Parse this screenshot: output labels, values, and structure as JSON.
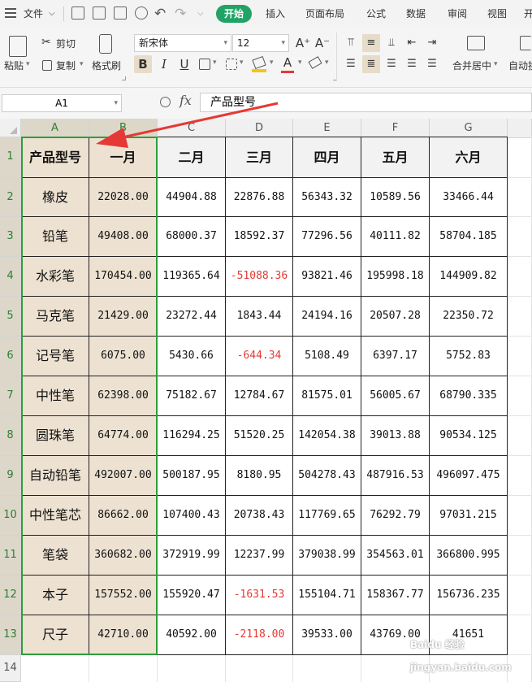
{
  "menubar": {
    "file_label": "文件",
    "tabs": [
      "开始",
      "插入",
      "页面布局",
      "公式",
      "数据",
      "审阅",
      "视图",
      "开"
    ],
    "active_tab": "开始"
  },
  "toolbar": {
    "paste_label": "粘贴",
    "cut_label": "剪切",
    "copy_label": "复制",
    "format_painter_label": "格式刷",
    "font_name": "新宋体",
    "font_size": "12",
    "bold": "B",
    "italic": "I",
    "underline": "U",
    "font_color_glyph": "A",
    "grow_font": "A⁺",
    "shrink_font": "A⁻",
    "merge_center_label": "合并居中",
    "wrap_label": "自动换"
  },
  "formula_bar": {
    "name_box": "A1",
    "fx_label": "fx",
    "content": "产品型号"
  },
  "columns": [
    "A",
    "B",
    "C",
    "D",
    "E",
    "F",
    "G"
  ],
  "selected_columns": [
    "A",
    "B"
  ],
  "rows": [
    "1",
    "2",
    "3",
    "4",
    "5",
    "6",
    "7",
    "8",
    "9",
    "10",
    "11",
    "12",
    "13",
    "14"
  ],
  "table": {
    "headers": [
      "产品型号",
      "一月",
      "二月",
      "三月",
      "四月",
      "五月",
      "六月"
    ],
    "rows": [
      [
        "橡皮",
        "22028.00",
        "44904.88",
        "22876.88",
        "56343.32",
        "10589.56",
        "33466.44"
      ],
      [
        "铅笔",
        "49408.00",
        "68000.37",
        "18592.37",
        "77296.56",
        "40111.82",
        "58704.185"
      ],
      [
        "水彩笔",
        "170454.00",
        "119365.64",
        "-51088.36",
        "93821.46",
        "195998.18",
        "144909.82"
      ],
      [
        "马克笔",
        "21429.00",
        "23272.44",
        "1843.44",
        "24194.16",
        "20507.28",
        "22350.72"
      ],
      [
        "记号笔",
        "6075.00",
        "5430.66",
        "-644.34",
        "5108.49",
        "6397.17",
        "5752.83"
      ],
      [
        "中性笔",
        "62398.00",
        "75182.67",
        "12784.67",
        "81575.01",
        "56005.67",
        "68790.335"
      ],
      [
        "圆珠笔",
        "64774.00",
        "116294.25",
        "51520.25",
        "142054.38",
        "39013.88",
        "90534.125"
      ],
      [
        "自动铅笔",
        "492007.00",
        "500187.95",
        "8180.95",
        "504278.43",
        "487916.53",
        "496097.475"
      ],
      [
        "中性笔芯",
        "86662.00",
        "107400.43",
        "20738.43",
        "117769.65",
        "76292.79",
        "97031.215"
      ],
      [
        "笔袋",
        "360682.00",
        "372919.99",
        "12237.99",
        "379038.99",
        "354563.01",
        "366800.995"
      ],
      [
        "本子",
        "157552.00",
        "155920.47",
        "-1631.53",
        "155104.71",
        "158367.77",
        "156736.235"
      ],
      [
        "尺子",
        "42710.00",
        "40592.00",
        "-2118.00",
        "39533.00",
        "43769.00",
        "41651"
      ]
    ]
  },
  "colors": {
    "accent": "#21a366",
    "selection_border": "#2e9e3a",
    "selected_fill": "#ede2d2",
    "negative": "#e53935",
    "arrow": "#e53935"
  },
  "watermark_text": "Baidu 经验 jingyan.baidu.com"
}
